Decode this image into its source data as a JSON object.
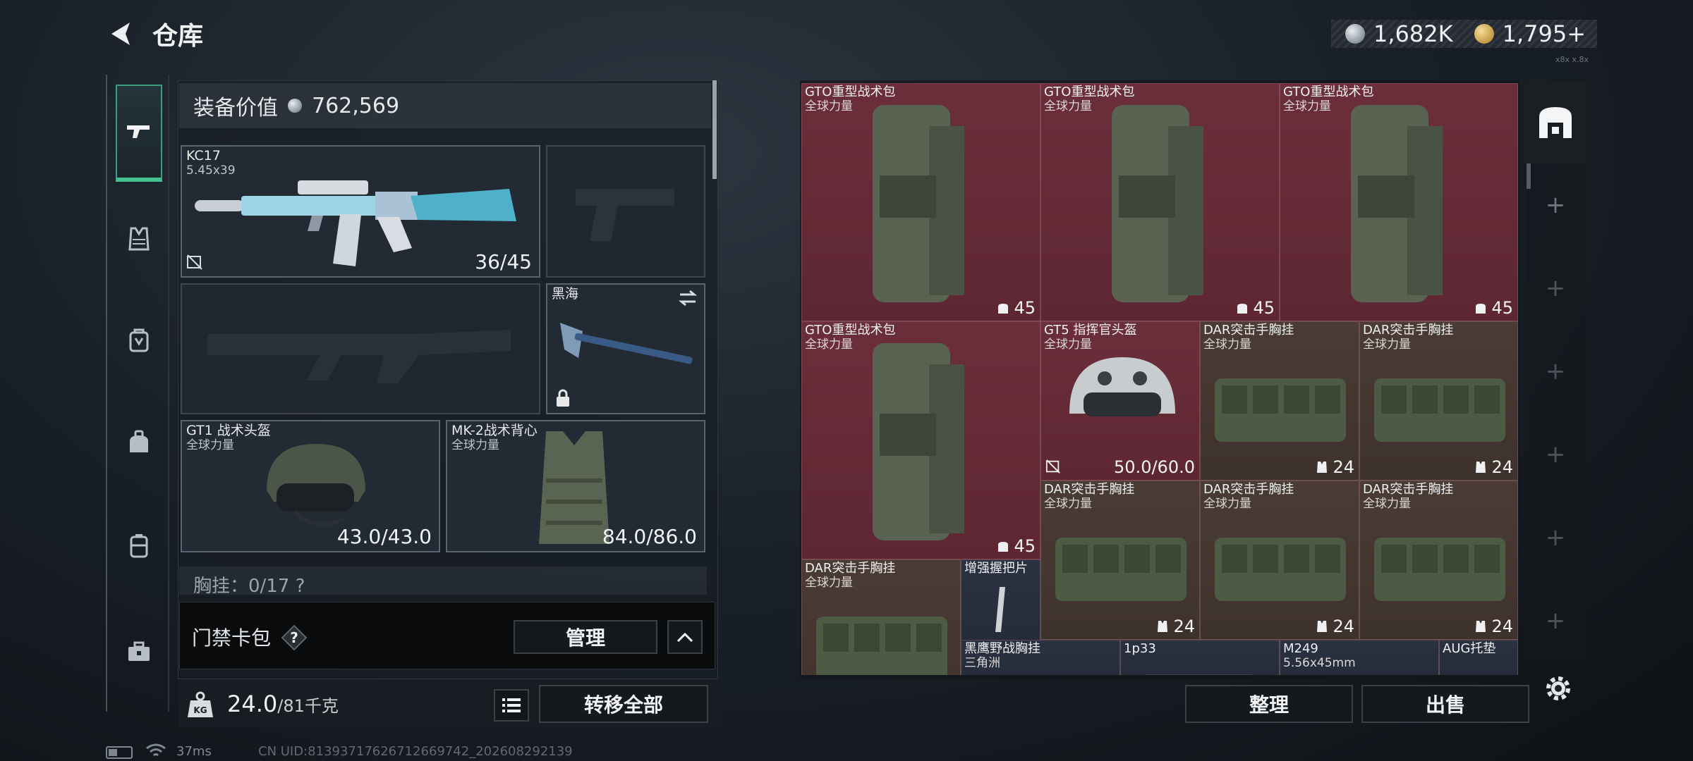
{
  "header": {
    "title": "仓库",
    "currency_silver": "1,682K",
    "currency_gold": "1,795+",
    "version_text": "x8x x.8x"
  },
  "nav": {
    "items": [
      "firearms-icon",
      "vest-icon",
      "backpack-icon",
      "bag-icon",
      "container-icon",
      "case-icon"
    ],
    "active": "firearms-icon"
  },
  "equipment": {
    "value_label": "装备价值",
    "value": "762,569",
    "primary_weapon": {
      "name": "KC17",
      "ammo": "5.45x39",
      "value": "36/45"
    },
    "melee": {
      "name": "黑海"
    },
    "helmet": {
      "name": "GT1 战术头盔",
      "faction": "全球力量",
      "value": "43.0/43.0"
    },
    "armor": {
      "name": "MK-2战术背心",
      "faction": "全球力量",
      "value": "84.0/86.0"
    },
    "chest_rig_row": "胸挂：0/17 ?",
    "keycard_label": "门禁卡包",
    "manage_label": "管理",
    "weight_current": "24.0",
    "weight_max": "/81千克",
    "transfer_all": "转移全部"
  },
  "stash": {
    "cells": [
      {
        "name": "GTO重型战术包",
        "sub": "全球力量",
        "value": "45",
        "badge": "bag"
      },
      {
        "name": "GTO重型战术包",
        "sub": "全球力量",
        "value": "45",
        "badge": "bag"
      },
      {
        "name": "GTO重型战术包",
        "sub": "全球力量",
        "value": "45",
        "badge": "bag"
      },
      {
        "name": "GTO重型战术包",
        "sub": "全球力量",
        "value": "45",
        "badge": "bag"
      },
      {
        "name": "GT5 指挥官头盔",
        "sub": "全球力量",
        "value": "50.0/60.0",
        "badge": "nodur"
      },
      {
        "name": "DAR突击手胸挂",
        "sub": "全球力量",
        "value": "24",
        "badge": "vest"
      },
      {
        "name": "DAR突击手胸挂",
        "sub": "全球力量",
        "value": "24",
        "badge": "vest"
      },
      {
        "name": "DAR突击手胸挂",
        "sub": "全球力量",
        "value": "24",
        "badge": "vest"
      },
      {
        "name": "DAR突击手胸挂",
        "sub": "全球力量",
        "value": "24",
        "badge": "vest"
      },
      {
        "name": "DAR突击手胸挂",
        "sub": "全球力量",
        "value": "24",
        "badge": "vest"
      },
      {
        "name": "DAR突击手胸挂",
        "sub": "全球力量",
        "value": "",
        "badge": ""
      },
      {
        "name": "增强握把片",
        "sub": "",
        "value": "",
        "badge": ""
      },
      {
        "name": "黑鹰野战胸挂",
        "sub": "三角洲",
        "value": "",
        "badge": ""
      },
      {
        "name": "1p33",
        "sub": "",
        "value": "",
        "badge": ""
      },
      {
        "name": "M249",
        "sub": "5.56x45mm",
        "value": "",
        "badge": ""
      },
      {
        "name": "AUG托垫",
        "sub": "",
        "value": "",
        "badge": ""
      }
    ],
    "sort_label": "整理",
    "sell_label": "出售"
  },
  "status": {
    "ping": "37ms",
    "uid": "CN UID:8139371762671266974​2_202608292139"
  },
  "colors": {
    "accent": "#42c08f",
    "stash_red": "#6b2f3b"
  }
}
